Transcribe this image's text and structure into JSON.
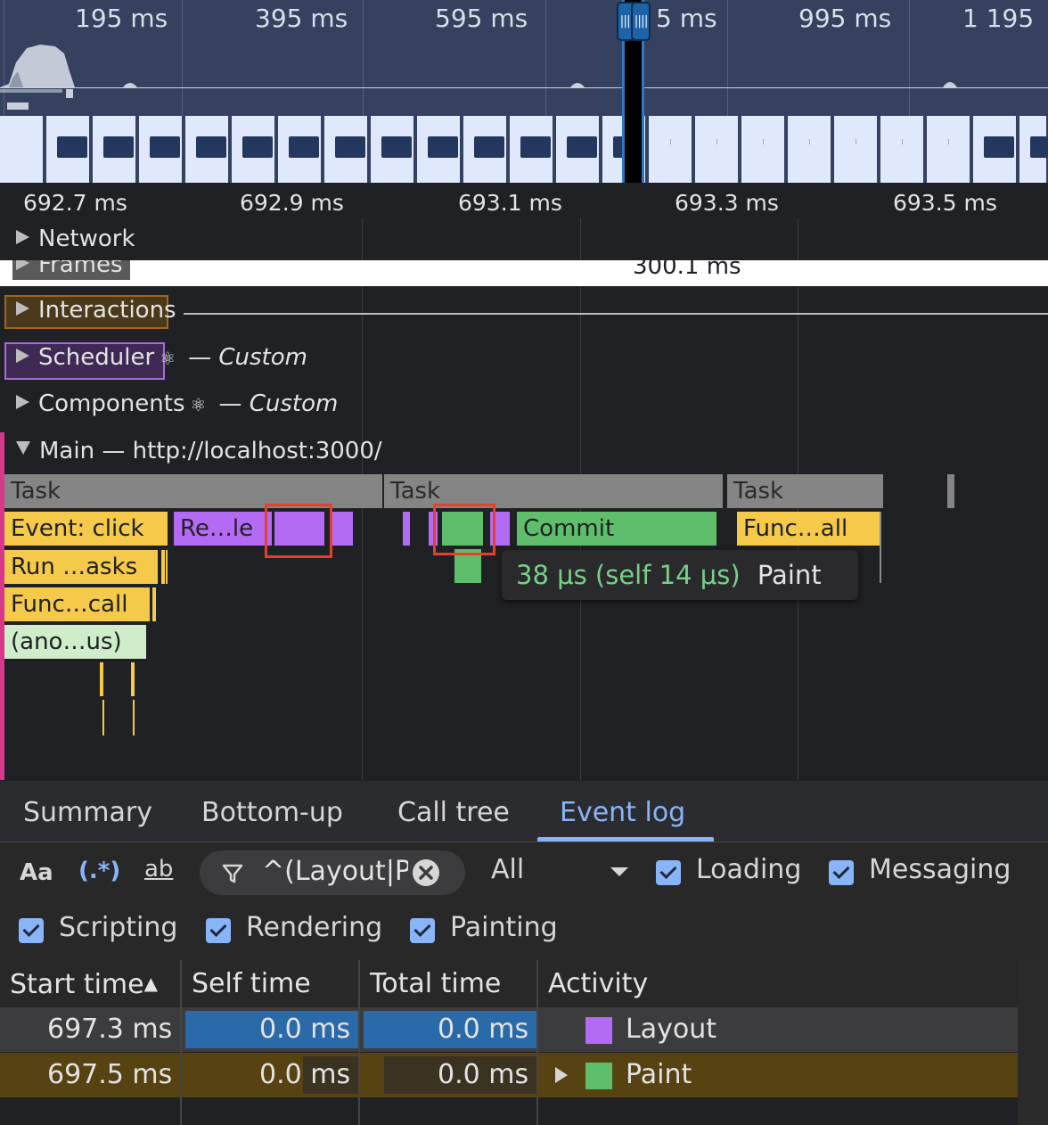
{
  "overview": {
    "labels": [
      "195 ms",
      "395 ms",
      "595 ms",
      "5 ms",
      "995 ms",
      "1 195"
    ],
    "handle_glyph": "||||"
  },
  "ruler": {
    "labels": [
      "692.7 ms",
      "692.9 ms",
      "693.1 ms",
      "693.3 ms",
      "693.5 ms"
    ]
  },
  "tracks": {
    "network": "Network",
    "frames": "Frames",
    "frames_value": "300.1 ms",
    "interactions": "Interactions",
    "scheduler": "Scheduler",
    "scheduler_custom": "— Custom",
    "components": "Components",
    "components_custom": "— Custom",
    "main": "Main — http://localhost:3000/",
    "react_icon": "⚛"
  },
  "flame": {
    "task1": "Task",
    "task2": "Task",
    "task3": "Task",
    "event_click": "Event: click",
    "render": "Re…le",
    "commit": "Commit",
    "func_all": "Func…all",
    "run_tasks": "Run …asks",
    "func_call": "Func…call",
    "anonymous": "(ano…us)"
  },
  "tooltip": {
    "duration": "38 μs (self 14 μs)",
    "name": "Paint"
  },
  "tabs": {
    "summary": "Summary",
    "bottom_up": "Bottom-up",
    "call_tree": "Call tree",
    "event_log": "Event log"
  },
  "filter": {
    "match_case": "Aa",
    "regex": "(.*)",
    "whole_word": "ab",
    "filter_value": "^(Layout|P",
    "level": "All",
    "loading": "Loading",
    "messaging": "Messaging",
    "scripting": "Scripting",
    "rendering": "Rendering",
    "painting": "Painting"
  },
  "table": {
    "headers": {
      "start_time": "Start time",
      "sort_arrow": "▲",
      "self_time": "Self time",
      "total_time": "Total time",
      "activity": "Activity"
    },
    "rows": [
      {
        "start": "697.3 ms",
        "self": "0.0 ms",
        "total": "0.0 ms",
        "activity": "Layout",
        "color": "#b36bf5"
      },
      {
        "start": "697.5 ms",
        "self": "0.0 ms",
        "total": "0.0 ms",
        "activity": "Paint",
        "color": "#5fbe6c"
      }
    ]
  },
  "colors": {
    "selected_row": "#3c3c3f",
    "highlight_row": "#574211",
    "bar_blue": "#2a6aa9",
    "accent": "#8ab4f8"
  }
}
